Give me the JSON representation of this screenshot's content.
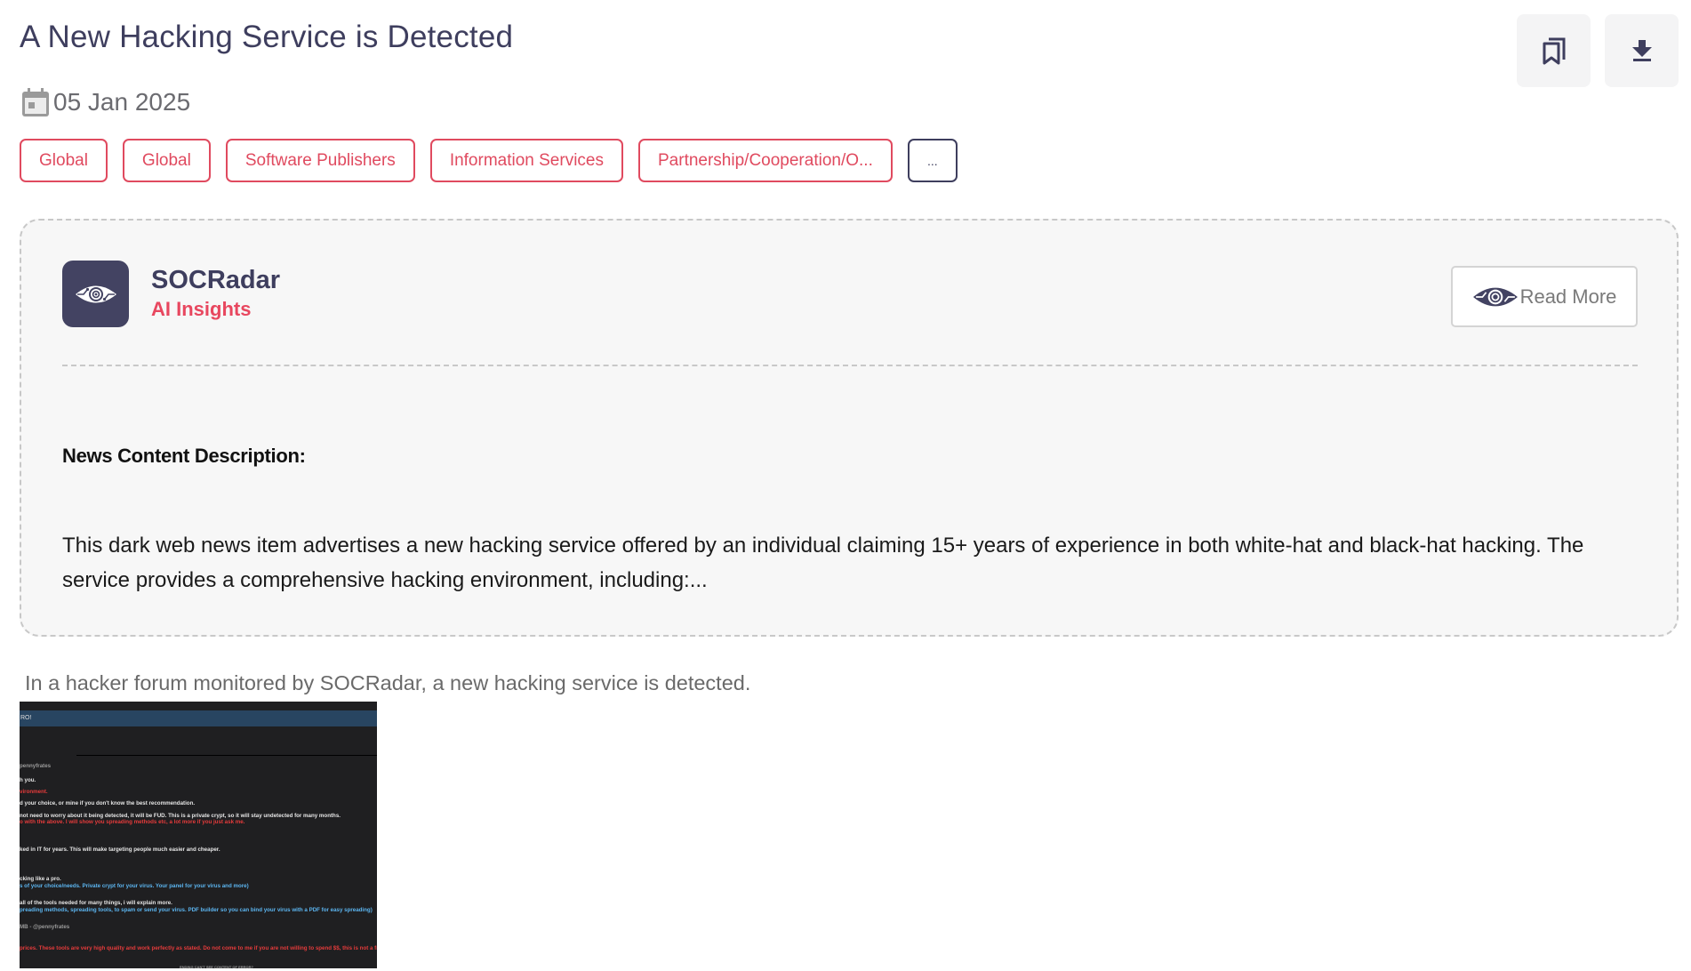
{
  "header": {
    "title": "A New Hacking Service is Detected",
    "date": "05 Jan 2025",
    "date_icon": "calendar-icon",
    "actions": [
      {
        "name": "bookmark",
        "icon": "bookmark-icon"
      },
      {
        "name": "download",
        "icon": "download-icon"
      }
    ]
  },
  "tags": [
    "Global",
    "Global",
    "Software Publishers",
    "Information Services",
    "Partnership/Cooperation/O...",
    "..."
  ],
  "ai_insights": {
    "brand_name": "SOCRadar",
    "brand_sub": "AI Insights",
    "logo_icon": "eye-radar-icon",
    "read_more_label": "Read More",
    "section_heading": "News Content Description:",
    "description": "This dark web news item advertises a new hacking service offered by an individual claiming 15+ years of experience in both white-hat and black-hat hacking. The service provides a comprehensive hacking environment, including:..."
  },
  "article": {
    "caption": "In a hacker forum monitored by SOCRadar, a new hacking service is detected.",
    "screenshot": {
      "alt": "Hacker forum post screenshot",
      "topbar": "RO!",
      "lines": [
        {
          "text": "pennyfrates",
          "tone": "g"
        },
        {
          "text": "h you.",
          "tone": "w"
        },
        {
          "text": "vironment.",
          "tone": "r"
        },
        {
          "text": "d your choice, or mine if you don't know the best recommendation.",
          "tone": "w"
        },
        {
          "text": "not need to worry about it being detected, it will be FUD. This is a private crypt, so it will stay undetected for many months.",
          "tone": "w"
        },
        {
          "text": "o with the above. I will show you spreading methods etc, a lot more if you just ask me.",
          "tone": "r"
        },
        {
          "text": "ked in IT for years. This will make targeting people much easier and cheaper.",
          "tone": "w"
        },
        {
          "text": "cking like a pro.",
          "tone": "w"
        },
        {
          "text": "s of your choice/needs. Private crypt for your virus. Your panel for your virus and more)",
          "tone": "b"
        },
        {
          "text": "all of the tools needed for many things, i will explain more.",
          "tone": "w"
        },
        {
          "text": "preading methods, spreading tools, to spam or send your virus. PDF builder so you can bind your virus with a PDF for easy spreading)",
          "tone": "b"
        },
        {
          "text": "MB - @pennyfrates",
          "tone": "g"
        },
        {
          "text": "prices. These tools are very high quality and work perfectly as stated. Do not come to me if you are not willing to spend $$, this is not a free service",
          "tone": "r"
        },
        {
          "text": "ENDING CAN'T SEE CONTENT OF ERROR?",
          "tone": "g"
        }
      ]
    }
  }
}
